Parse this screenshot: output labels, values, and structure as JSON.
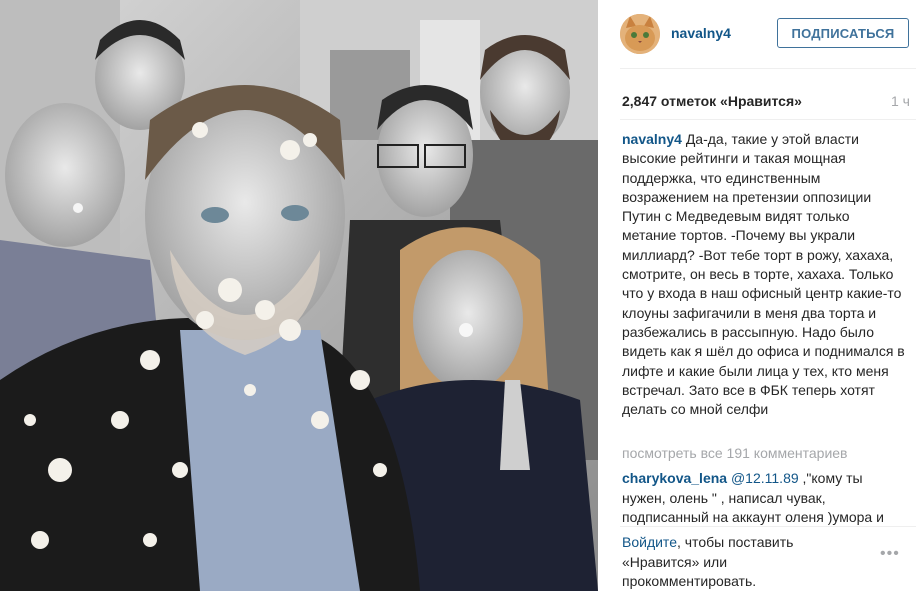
{
  "post": {
    "username": "navalny4",
    "follow_label": "ПОДПИСАТЬСЯ",
    "likes": "2,847 отметок «Нравится»",
    "time_ago": "1 ч",
    "caption_text": "Да-да, такие у этой власти высокие рейтинги и такая мощная поддержка, что единственным возражением на претензии оппозиции Путин с Медведевым видят только метание тортов. -Почему вы украли миллиард? -Вот тебе торт в рожу, хахаха, смотрите, он весь в торте, хахаха. Только что у входа в наш офисный центр какие-то клоуны зафигачили в меня два торта и разбежались в рассыпную. Надо было видеть как я шёл до офиса и поднимался в лифте и какие были лица у тех, кто меня встречал. Зато все в ФБК теперь хотят делать со мной селфи",
    "view_all_comments": "посмотреть все 191 комментариев"
  },
  "comment": {
    "username": "charykova_lena",
    "mention": "@12.11.89",
    "text": " ,\"кому ты нужен, олень \" , написал чувак, подписанный на аккаунт оленя )умора и"
  },
  "login_prompt": {
    "link": "Войдите",
    "text": ", чтобы поставить «Нравится» или прокомментировать."
  },
  "more_options": "•••",
  "colors": {
    "link": "#125688",
    "follow_border": "#3f729b",
    "muted": "#a5a7aa"
  }
}
